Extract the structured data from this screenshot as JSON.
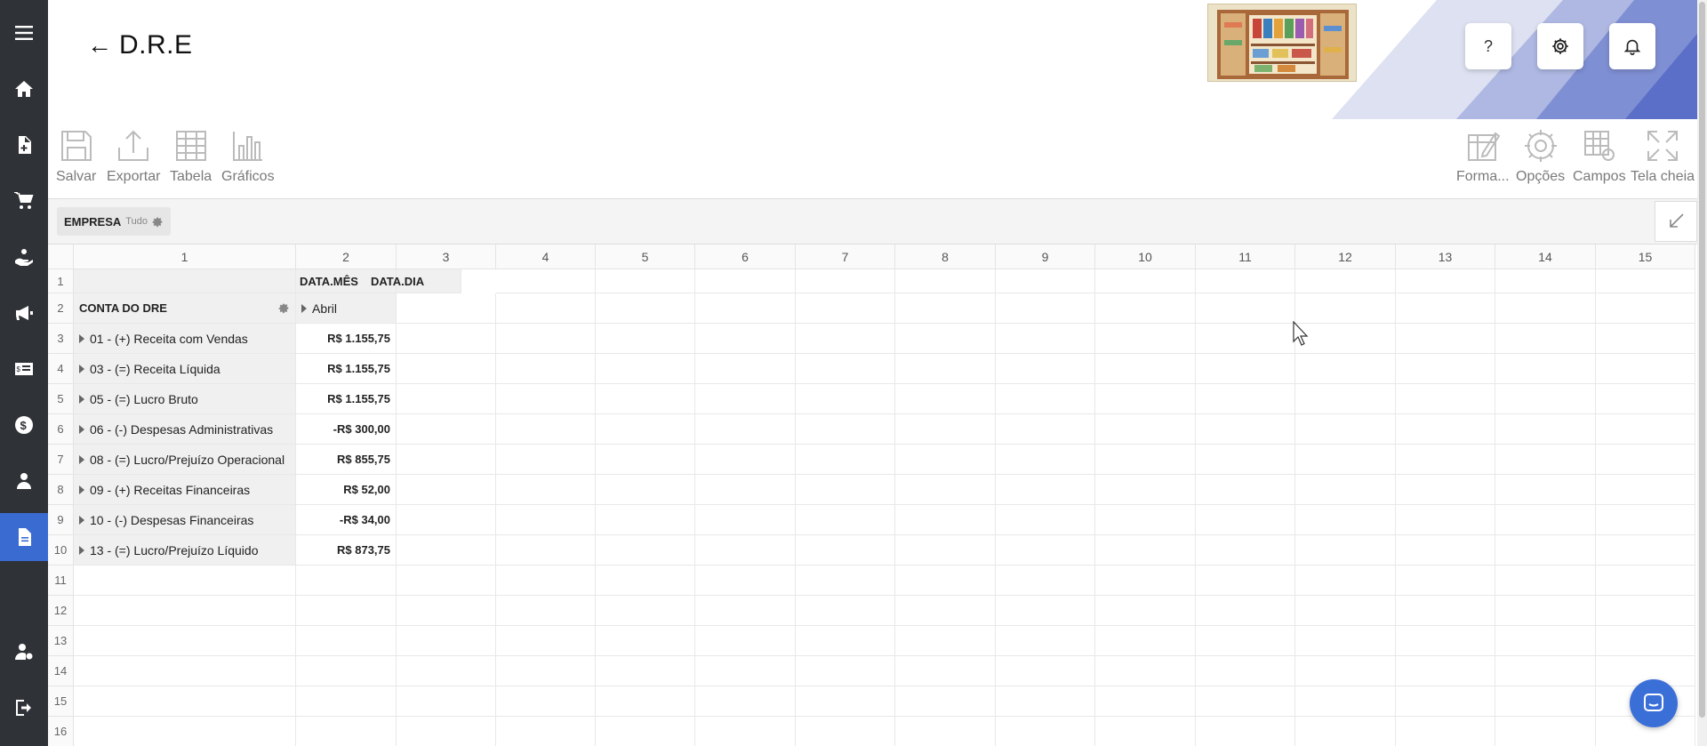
{
  "header": {
    "back_arrow": "←",
    "title": "D.R.E",
    "help_label": "?"
  },
  "colors": {
    "sidebar": "#2f3236",
    "accent": "#3a6bd1",
    "deco_dark": "#5b74c9",
    "deco_light": "#c7cdea"
  },
  "sidebar": {
    "items": [
      {
        "icon": "menu-icon"
      },
      {
        "icon": "home-icon"
      },
      {
        "icon": "document-add-icon"
      },
      {
        "icon": "cart-icon"
      },
      {
        "icon": "hand-coin-icon"
      },
      {
        "icon": "megaphone-icon"
      },
      {
        "icon": "money-card-icon"
      },
      {
        "icon": "dollar-circle-icon"
      },
      {
        "icon": "users-icon"
      },
      {
        "icon": "report-icon",
        "active": true
      },
      {
        "icon": "user-settings-icon"
      },
      {
        "icon": "logout-icon"
      }
    ]
  },
  "toolbar": {
    "left": [
      {
        "icon": "save-icon",
        "label": "Salvar"
      },
      {
        "icon": "export-icon",
        "label": "Exportar"
      },
      {
        "icon": "table-icon",
        "label": "Tabela"
      },
      {
        "icon": "chart-icon",
        "label": "Gráficos"
      }
    ],
    "right": [
      {
        "icon": "format-icon",
        "label": "Forma..."
      },
      {
        "icon": "options-icon",
        "label": "Opções"
      },
      {
        "icon": "fields-icon",
        "label": "Campos"
      },
      {
        "icon": "fullscreen-icon",
        "label": "Tela cheia"
      }
    ]
  },
  "filter": {
    "label": "EMPRESA",
    "value": "Tudo"
  },
  "grid": {
    "columns": [
      "1",
      "2",
      "3",
      "4",
      "5",
      "6",
      "7",
      "8",
      "9",
      "10",
      "11",
      "12",
      "13",
      "14",
      "15"
    ],
    "rows": [
      "1",
      "2",
      "3",
      "4",
      "5",
      "6",
      "7",
      "8",
      "9",
      "10",
      "11",
      "12",
      "13",
      "14",
      "15",
      "16"
    ],
    "col_fields": [
      "DATA.MÊS",
      "DATA.DIA"
    ],
    "row_field": "CONTA DO DRE",
    "month": "Abril",
    "accounts": [
      {
        "label": "01 - (+) Receita com Vendas",
        "value": "R$ 1.155,75"
      },
      {
        "label": "03 - (=) Receita Líquida",
        "value": "R$ 1.155,75"
      },
      {
        "label": "05 - (=) Lucro Bruto",
        "value": "R$ 1.155,75"
      },
      {
        "label": "06 - (-) Despesas Administrativas",
        "value": "-R$ 300,00"
      },
      {
        "label": "08 - (=) Lucro/Prejuízo Operacional",
        "value": "R$ 855,75"
      },
      {
        "label": "09 - (+) Receitas Financeiras",
        "value": "R$ 52,00"
      },
      {
        "label": "10 - (-) Despesas Financeiras",
        "value": "-R$ 34,00"
      },
      {
        "label": "13 - (=) Lucro/Prejuízo Líquido",
        "value": "R$ 873,75"
      }
    ]
  }
}
